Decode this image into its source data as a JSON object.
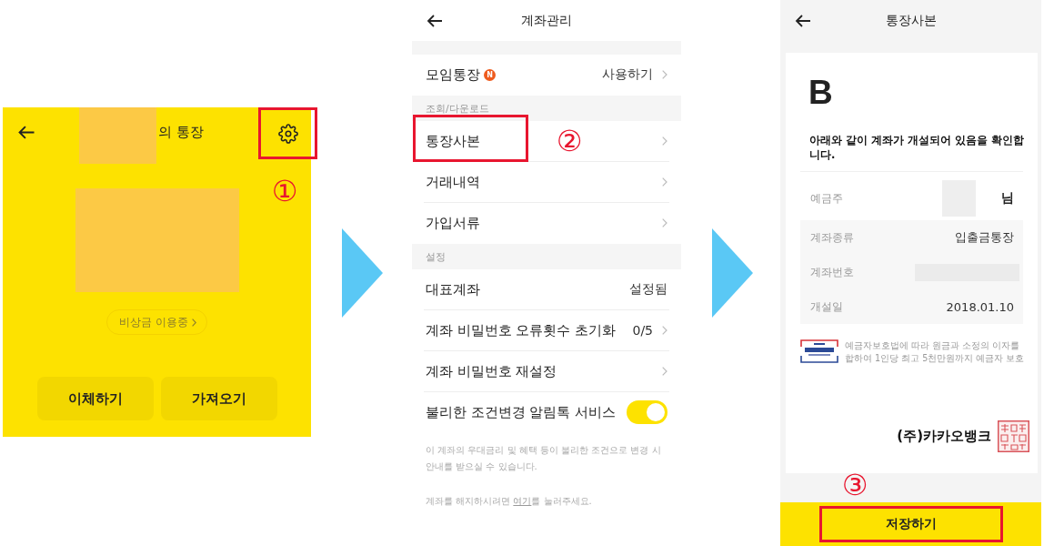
{
  "screens": [
    {
      "kind": "account",
      "title": "의 통장",
      "settings": {
        "highlighted": true,
        "step": "①"
      },
      "status_pill": "비상금 이용중",
      "actions": [
        {
          "label": "이체하기"
        },
        {
          "label": "가져오기"
        }
      ]
    },
    {
      "kind": "menu",
      "title": "계좌관리",
      "sections": [
        {
          "items": [
            {
              "kind": "link",
              "label": "모임통장",
              "badge": "N",
              "value": "사용하기",
              "chevron": true,
              "highlighted": false
            }
          ]
        },
        {
          "header": "조회/다운로드",
          "items": [
            {
              "kind": "link",
              "label": "통장사본",
              "chevron": true,
              "highlighted": true,
              "step": "②"
            },
            {
              "kind": "link",
              "label": "거래내역",
              "chevron": true,
              "highlighted": false
            },
            {
              "kind": "link",
              "label": "가입서류",
              "chevron": true,
              "highlighted": false
            }
          ]
        },
        {
          "header": "설정",
          "items": [
            {
              "kind": "link",
              "label": "대표계좌",
              "value": "설정됨",
              "chevron": false,
              "highlighted": false
            },
            {
              "kind": "link",
              "label": "계좌 비밀번호 오류횟수 초기화",
              "value": "0/5",
              "chevron": true,
              "highlighted": false
            },
            {
              "kind": "link",
              "label": "계좌 비밀번호 재설정",
              "chevron": true,
              "highlighted": false
            },
            {
              "kind": "toggle",
              "label": "불리한 조건변경 알림톡 서비스",
              "on": true,
              "chevron": false,
              "highlighted": false
            }
          ]
        }
      ],
      "note": "이 계좌의 우대금리 및 혜택 등이 불리한 조건으로 변경 시 안내를 받으실 수 있습니다.",
      "close_note": {
        "before": "계좌를 해지하시려면 ",
        "link": "여기",
        "after": "를 눌러주세요."
      }
    },
    {
      "kind": "certificate",
      "title": "통장사본",
      "logo": "B",
      "statement": "아래와 같이 계좌가 개설되어 있음을 확인합니다.",
      "holder": {
        "label": "예금주",
        "value": "님",
        "redacted": true
      },
      "details": [
        {
          "label": "계좌종류",
          "value": "입출금통장",
          "redacted": false
        },
        {
          "label": "계좌번호",
          "redacted": true
        },
        {
          "label": "개설일",
          "value": "2018.01.10",
          "redacted": false
        }
      ],
      "protection_note": "예금자보호법에 따라 원금과 소정의 이자를 합하여 1인당 최고 5천만원까지 예금자 보호",
      "issuer": "(주)카카오뱅크",
      "save": {
        "label": "저장하기",
        "highlighted": true,
        "step": "③"
      }
    }
  ]
}
